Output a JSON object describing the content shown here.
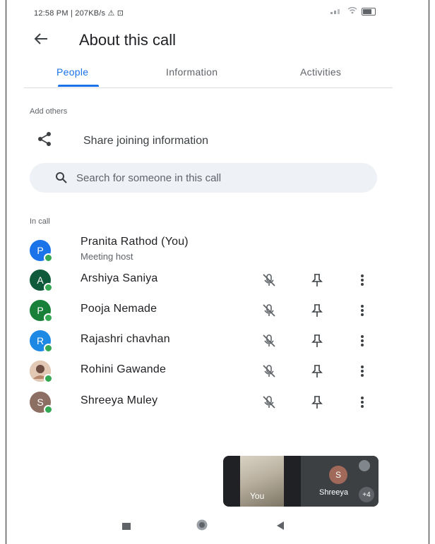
{
  "status_bar": {
    "text": "12:58 PM | 207KB/s ⚠ ⊡"
  },
  "header": {
    "title": "About this call"
  },
  "tabs": [
    {
      "label": "People",
      "active": true
    },
    {
      "label": "Information",
      "active": false
    },
    {
      "label": "Activities",
      "active": false
    }
  ],
  "add_others": {
    "section_label": "Add others",
    "share_label": "Share joining information",
    "search_placeholder": "Search for someone in this call"
  },
  "in_call": {
    "section_label": "In call",
    "participants": [
      {
        "initial": "P",
        "name": "Pranita Rathod (You)",
        "subtitle": "Meeting host",
        "avatar_color": "#1a73e8"
      },
      {
        "initial": "A",
        "name": "Arshiya Saniya",
        "avatar_color": "#0f5a3a"
      },
      {
        "initial": "P",
        "name": "Pooja Nemade",
        "avatar_color": "#188038"
      },
      {
        "initial": "R",
        "name": "Rajashri chavhan",
        "avatar_color": "#1e88e5"
      },
      {
        "initial": "",
        "name": "Rohini Gawande",
        "avatar_color": "#c9a48e"
      },
      {
        "initial": "S",
        "name": "Shreeya Muley",
        "avatar_color": "#8d6e63"
      }
    ]
  },
  "pip": {
    "self_label": "You",
    "other_initial": "S",
    "other_label": "Shreeya",
    "more_count": "+4"
  },
  "colors": {
    "accent": "#1a73e8",
    "online": "#34a853",
    "search_bg": "#eef1f6"
  }
}
